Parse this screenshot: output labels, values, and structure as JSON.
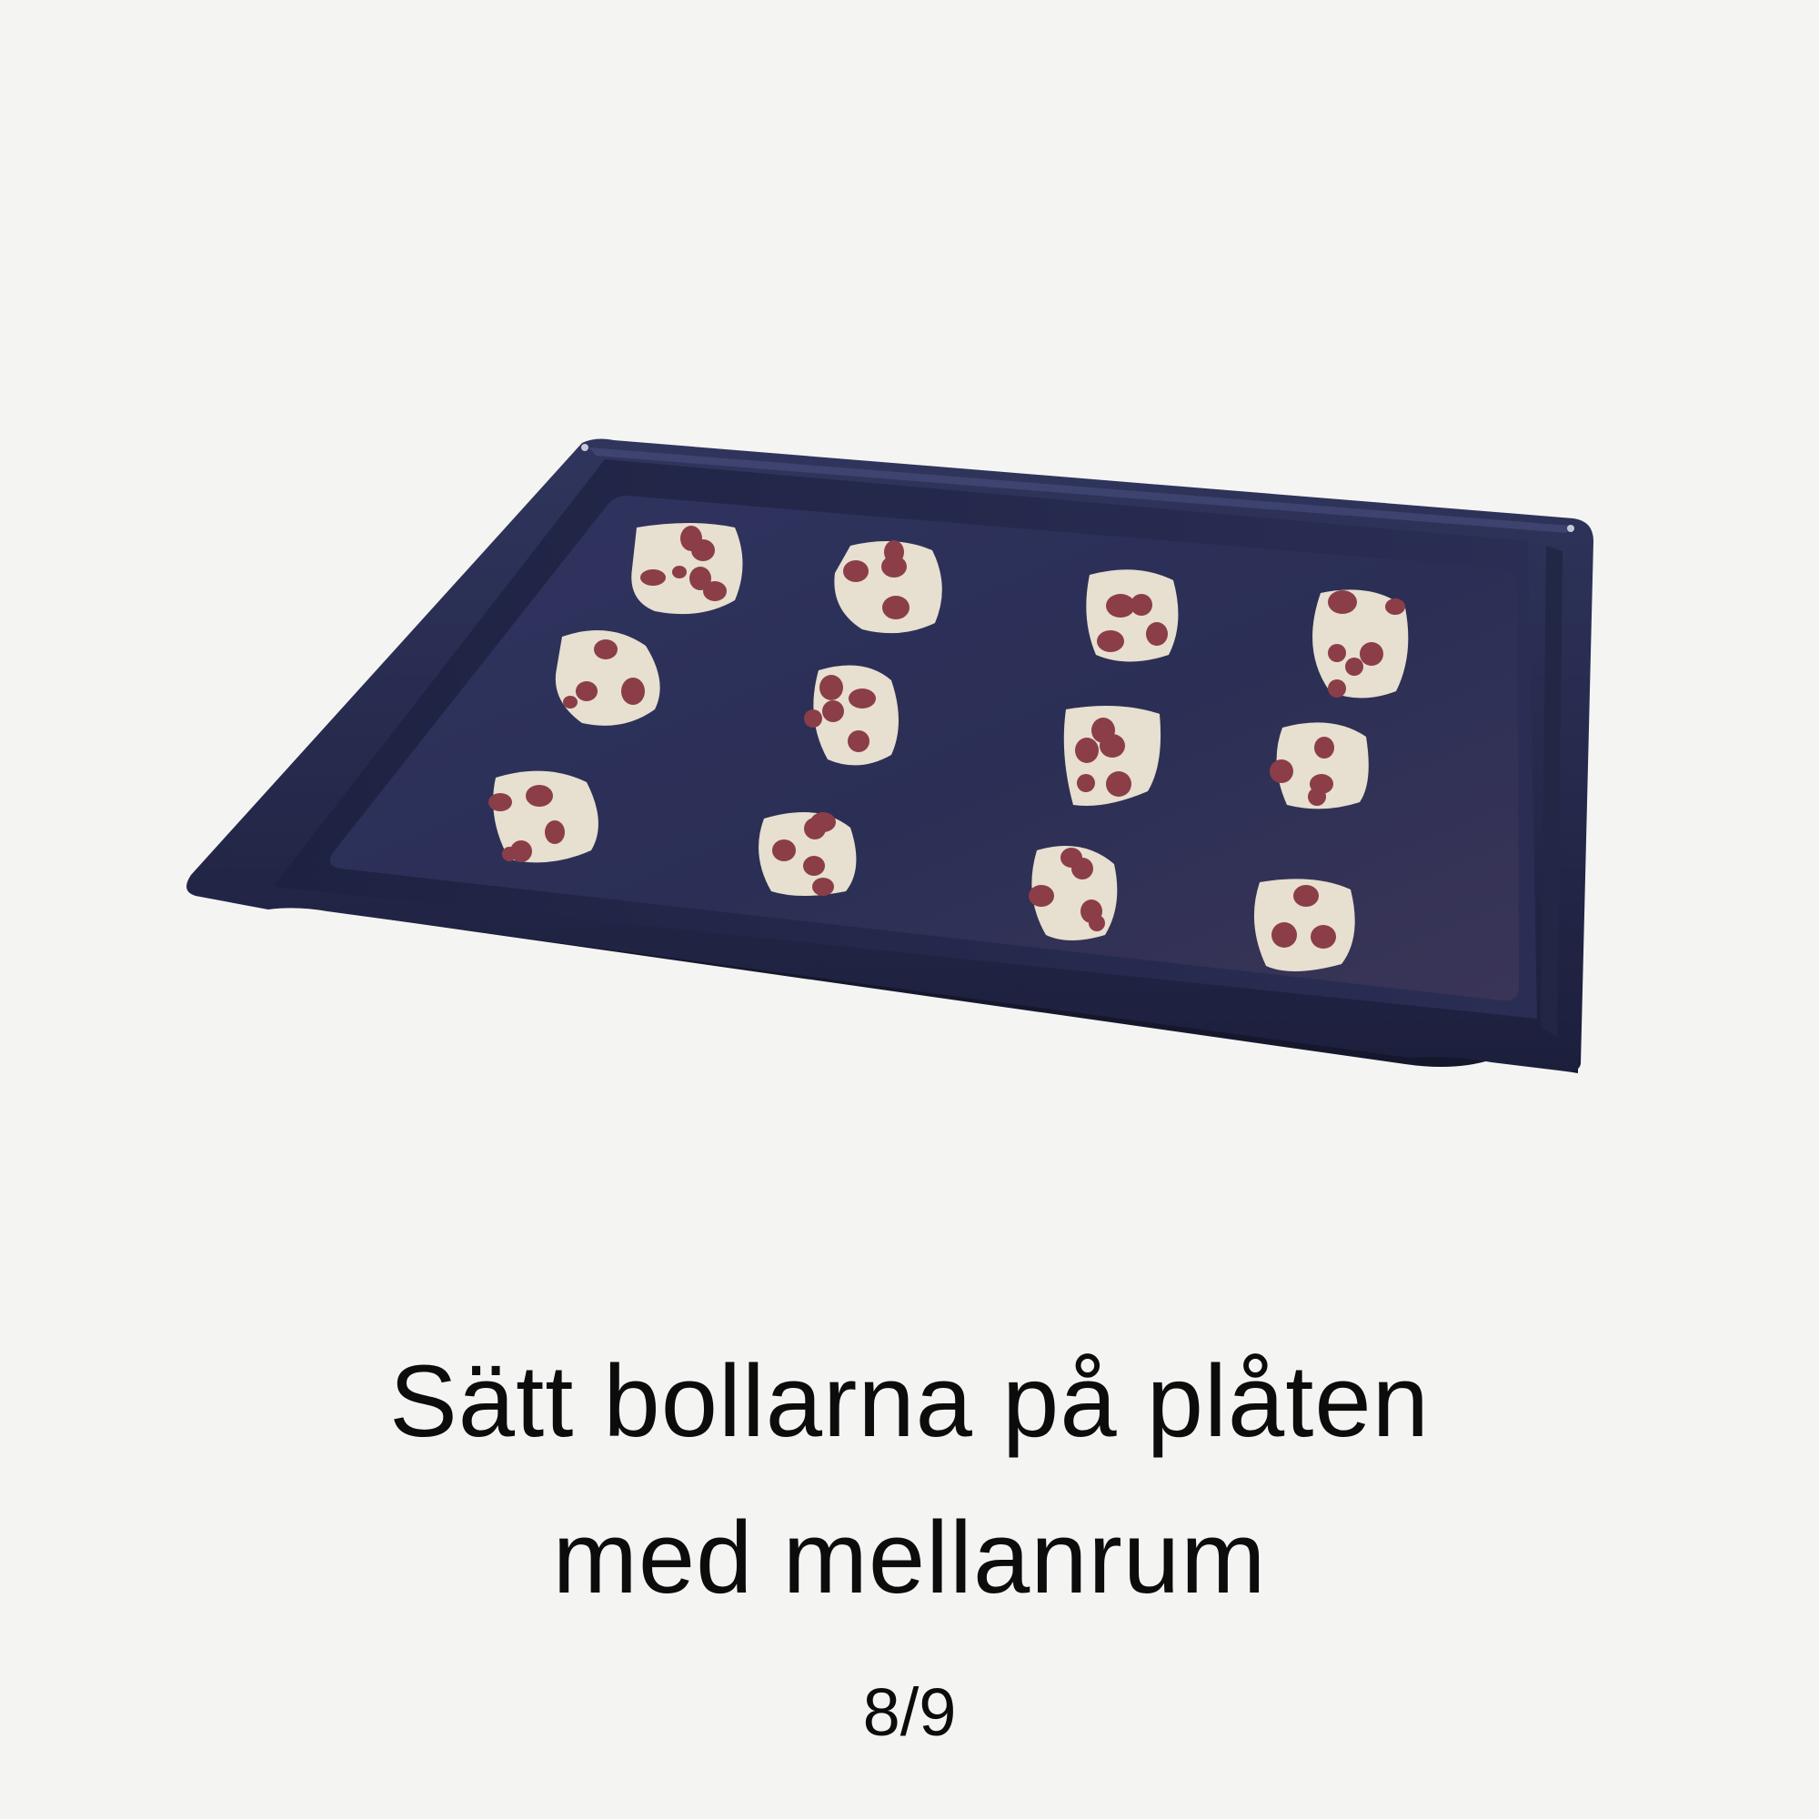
{
  "slide": {
    "caption_line1": "Sätt bollarna på plåten",
    "caption_line2": "med mellanrum",
    "page_counter": "8/9"
  },
  "illustration": {
    "tray_color": "#262a4c",
    "tray_rim_color": "#1d2140",
    "tray_floor_color": "#2d3157",
    "dough_color": "#e7dfcf",
    "chip_color": "#8b3e48",
    "dough_ball_count": 12
  }
}
